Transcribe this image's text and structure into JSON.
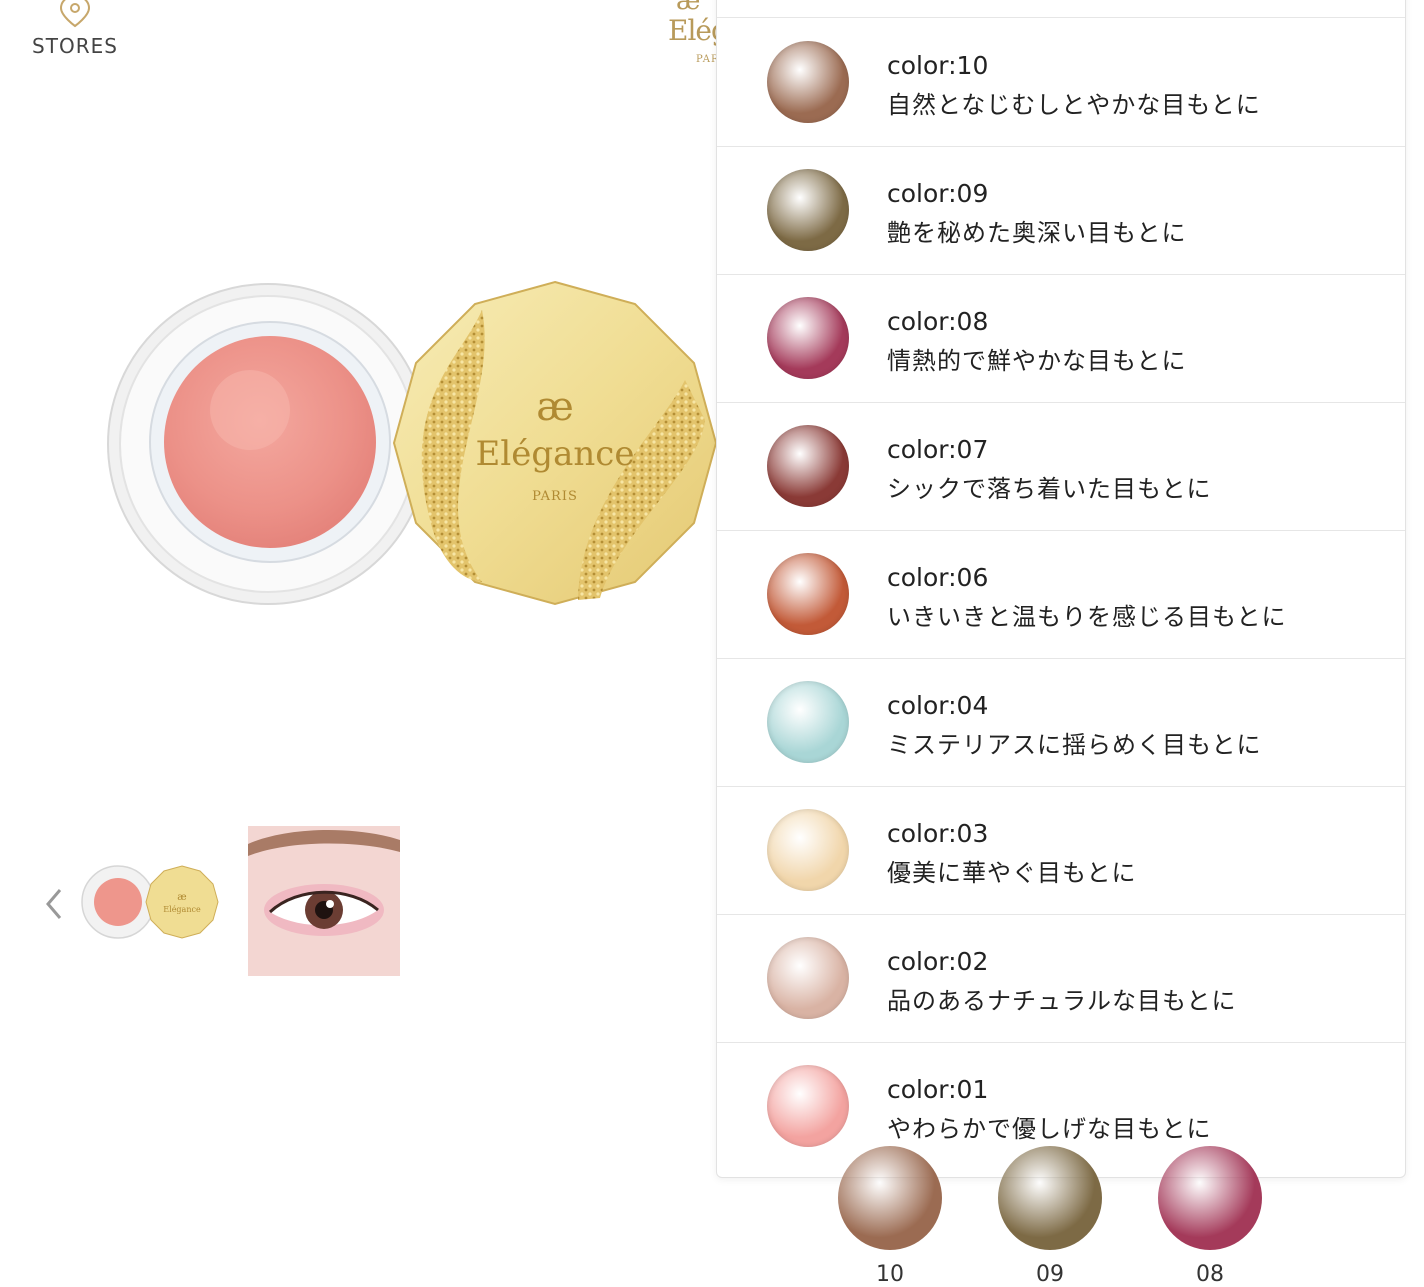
{
  "header": {
    "stores_label": "STORES",
    "logo": {
      "mark": "æ",
      "word": "Elég",
      "sub": "PAR"
    }
  },
  "product": {
    "lid_brand": "Elégance",
    "lid_mark": "æ",
    "lid_sub": "PARIS"
  },
  "thumbnails": {
    "prev_icon": "chevron-left-icon",
    "items": [
      {
        "name": "product-thumb"
      },
      {
        "name": "eye-look-thumb"
      }
    ]
  },
  "color_options": [
    {
      "code": "color:10",
      "desc": "自然となじむしとやかな目もとに",
      "color": "#9b6b52"
    },
    {
      "code": "color:09",
      "desc": "艶を秘めた奥深い目もとに",
      "color": "#7d6a45"
    },
    {
      "code": "color:08",
      "desc": "情熱的で鮮やかな目もとに",
      "color": "#a43a5a"
    },
    {
      "code": "color:07",
      "desc": "シックで落ち着いた目もとに",
      "color": "#8a3a36"
    },
    {
      "code": "color:06",
      "desc": "いきいきと温もりを感じる目もとに",
      "color": "#c25a38"
    },
    {
      "code": "color:04",
      "desc": "ミステリアスに揺らめく目もとに",
      "color": "#a9d6d6"
    },
    {
      "code": "color:03",
      "desc": "優美に華やぐ目もとに",
      "color": "#f1d6ab"
    },
    {
      "code": "color:02",
      "desc": "品のあるナチュラルな目もとに",
      "color": "#d9b3a4"
    },
    {
      "code": "color:01",
      "desc": "やわらかで優しげな目もとに",
      "color": "#f3a3a0"
    }
  ],
  "bottom_swatches": [
    {
      "label": "10",
      "color": "#9b6b52"
    },
    {
      "label": "09",
      "color": "#7d6a45"
    },
    {
      "label": "08",
      "color": "#a43a5a"
    }
  ]
}
